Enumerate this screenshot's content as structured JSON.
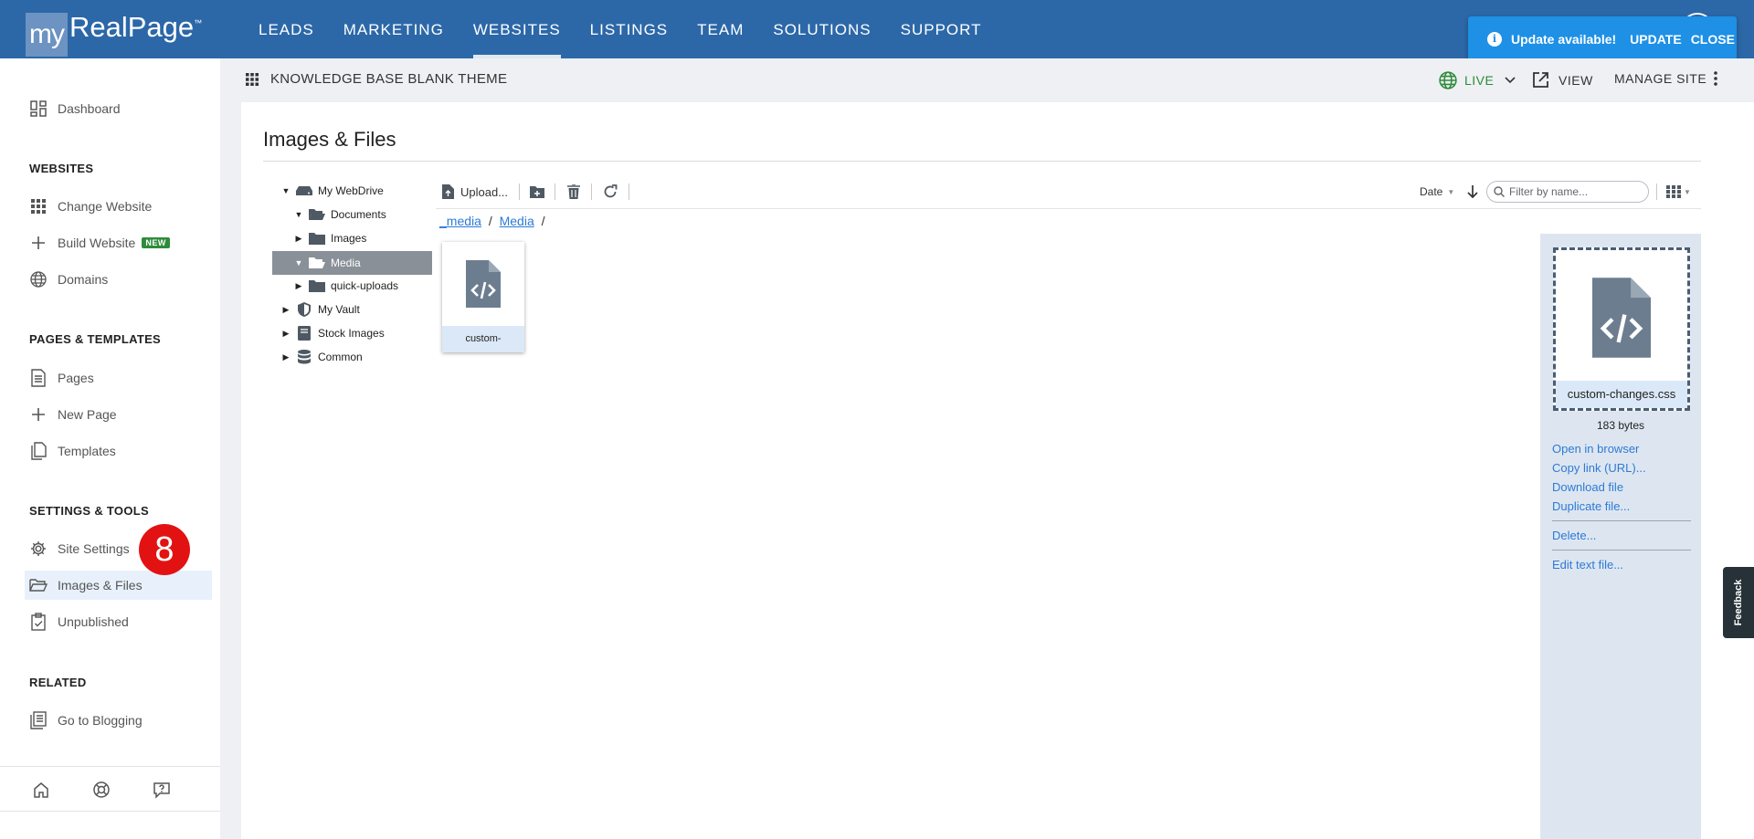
{
  "logo": {
    "my": "my",
    "rest": "RealPage",
    "tm": "™"
  },
  "nav": [
    "LEADS",
    "MARKETING",
    "WEBSITES",
    "LISTINGS",
    "TEAM",
    "SOLUTIONS",
    "SUPPORT"
  ],
  "toast": {
    "message": "Update available!",
    "update": "UPDATE",
    "close": "CLOSE"
  },
  "sidebar": {
    "dashboard": "Dashboard",
    "websites_head": "WEBSITES",
    "change_website": "Change Website",
    "build_website": "Build Website",
    "new_badge": "NEW",
    "domains": "Domains",
    "pages_head": "PAGES & TEMPLATES",
    "pages": "Pages",
    "new_page": "New Page",
    "templates": "Templates",
    "settings_head": "SETTINGS & TOOLS",
    "site_settings": "Site Settings",
    "images_files": "Images & Files",
    "unpublished": "Unpublished",
    "related_head": "RELATED",
    "go_blogging": "Go to Blogging"
  },
  "step_badge": "8",
  "header": {
    "site_name": "KNOWLEDGE BASE BLANK THEME",
    "live": "LIVE",
    "view": "VIEW",
    "manage": "MANAGE SITE"
  },
  "panel": {
    "title": "Images & Files"
  },
  "tree": {
    "webdrive": "My WebDrive",
    "documents": "Documents",
    "images": "Images",
    "media": "Media",
    "quick_uploads": "quick-uploads",
    "vault": "My Vault",
    "stock": "Stock Images",
    "common": "Common"
  },
  "toolbar": {
    "upload": "Upload...",
    "sort": "Date",
    "filter_placeholder": "Filter by name..."
  },
  "breadcrumb": {
    "root": "_media",
    "sep1": "/",
    "current": "Media",
    "sep2": "/"
  },
  "files": [
    {
      "name": "custom-"
    }
  ],
  "details": {
    "name": "custom-changes.css",
    "size": "183 bytes",
    "open": "Open in browser",
    "copy": "Copy link (URL)...",
    "download": "Download file",
    "duplicate": "Duplicate file...",
    "delete": "Delete...",
    "edit": "Edit text file..."
  },
  "feedback": "Feedback",
  "colors": {
    "nav_bg": "#2c68a8",
    "toast_bg": "#1e90e6",
    "live_green": "#2e8b3a",
    "link_blue": "#2d7ad6",
    "badge_red": "#e31212"
  }
}
